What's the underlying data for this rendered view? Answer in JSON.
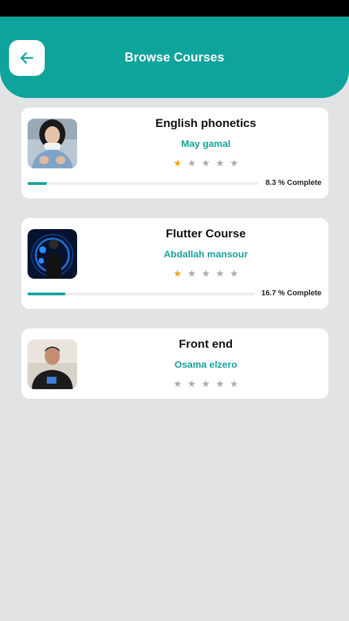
{
  "header": {
    "title": "Browse Courses"
  },
  "courses": [
    {
      "title": "English phonetics",
      "instructor": "May gamal",
      "rating": 1,
      "progress_pct": 8.3,
      "progress_text": "8.3 % Complete"
    },
    {
      "title": "Flutter Course",
      "instructor": "Abdallah mansour",
      "rating": 1,
      "progress_pct": 16.7,
      "progress_text": "16.7 % Complete"
    },
    {
      "title": "Front end",
      "instructor": "Osama elzero",
      "rating": 0
    }
  ],
  "colors": {
    "accent": "#0fa49b",
    "star_filled": "#f2a20f",
    "star_empty": "#a9abad",
    "background": "#e2e3e5"
  },
  "icons": {
    "back": "arrow-left-icon",
    "star": "star-icon"
  }
}
